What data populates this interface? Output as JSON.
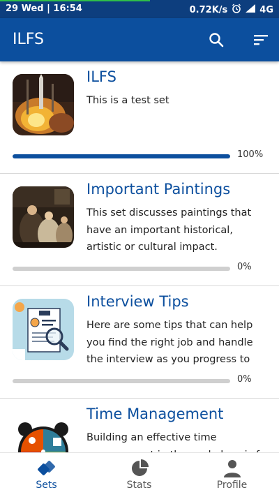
{
  "status_bar": {
    "left": "29 Wed  |  16:54",
    "speed": "0.72K/s",
    "network": "4G",
    "icons": [
      "alarm-icon",
      "signal-icon"
    ]
  },
  "app_bar": {
    "title": "ILFS",
    "icons": [
      "search-icon",
      "sort-filter-icon"
    ]
  },
  "sets": [
    {
      "title": "ILFS",
      "description": "This is a test set",
      "progress_label": "100%",
      "progress": 1.0,
      "thumbnail": "rocket-launch-image"
    },
    {
      "title": "Important Paintings",
      "description": "This set discusses paintings that have an important historical, artistic or cultural impact.",
      "progress_label": "0%",
      "progress": 0.0,
      "thumbnail": "painting-image"
    },
    {
      "title": "Interview Tips",
      "description": "Here are some tips that can help you find the right job and handle the interview as you progress to cl…",
      "progress_label": "0%",
      "progress": 0.0,
      "thumbnail": "cv-magnifier-image"
    },
    {
      "title": "Time Management",
      "description": "Building an effective time management in the workplace is f",
      "progress_label": "",
      "progress": 0.0,
      "thumbnail": "alarm-clock-image"
    }
  ],
  "bottom_nav": [
    {
      "label": "Sets",
      "icon": "sets-icon",
      "active": true
    },
    {
      "label": "Stats",
      "icon": "pie-chart-icon",
      "active": false
    },
    {
      "label": "Profile",
      "icon": "person-icon",
      "active": false
    }
  ],
  "colors": {
    "primary": "#0c4f9e",
    "status_bar": "#0d3e7e",
    "inactive": "#555555"
  }
}
